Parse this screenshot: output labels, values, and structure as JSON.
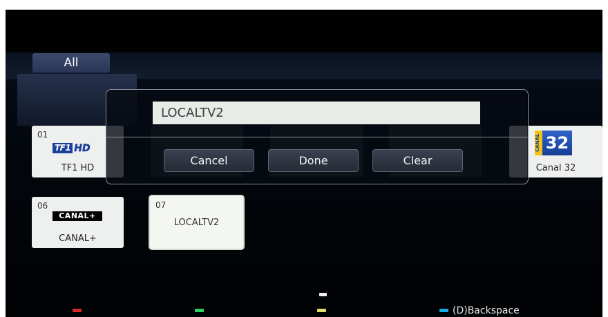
{
  "category_tab": {
    "label": "All"
  },
  "channels": [
    {
      "number": "01",
      "name": "TF1 HD",
      "logo": {
        "part1": "TF1",
        "part2": "HD"
      }
    },
    {
      "number": "06",
      "name": "CANAL+",
      "logo": {
        "text": "CANAL+"
      }
    },
    {
      "number": "07",
      "name": "LOCALTV2"
    },
    {
      "name": "Canal 32",
      "logo": {
        "strip": "CANAL",
        "number": "32"
      }
    }
  ],
  "rename_dialog": {
    "input_value": "LOCALTV2",
    "buttons": {
      "cancel": "Cancel",
      "done": "Done",
      "clear": "Clear"
    }
  },
  "footer": {
    "backspace_label": "(D)Backspace",
    "key_colors": {
      "red": "#d42a2a",
      "green": "#2bcf62",
      "yellow": "#e1de6a",
      "blue": "#1aa8e8"
    }
  }
}
